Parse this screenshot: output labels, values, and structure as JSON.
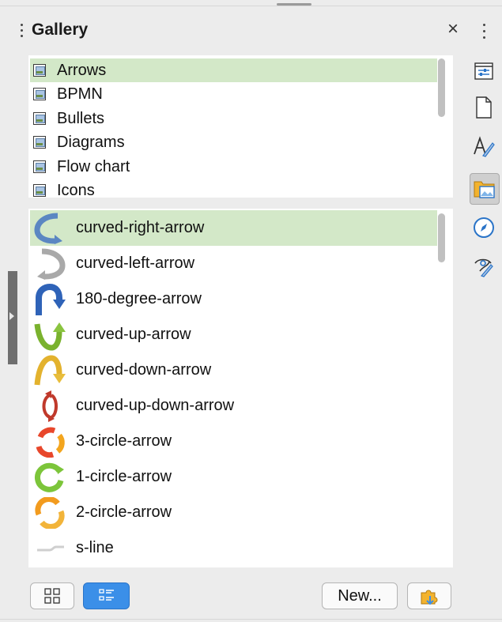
{
  "panel": {
    "title": "Gallery",
    "close_glyph": "×"
  },
  "themes": [
    {
      "label": "Arrows",
      "selected": true
    },
    {
      "label": "BPMN",
      "selected": false
    },
    {
      "label": "Bullets",
      "selected": false
    },
    {
      "label": "Diagrams",
      "selected": false
    },
    {
      "label": "Flow chart",
      "selected": false
    },
    {
      "label": "Icons",
      "selected": false
    }
  ],
  "items": [
    {
      "label": "curved-right-arrow",
      "selected": true,
      "icon": "curved-right-arrow-icon"
    },
    {
      "label": "curved-left-arrow",
      "selected": false,
      "icon": "curved-left-arrow-icon"
    },
    {
      "label": "180-degree-arrow",
      "selected": false,
      "icon": "u-turn-arrow-icon"
    },
    {
      "label": "curved-up-arrow",
      "selected": false,
      "icon": "curved-up-arrow-icon"
    },
    {
      "label": "curved-down-arrow",
      "selected": false,
      "icon": "curved-down-arrow-icon"
    },
    {
      "label": "curved-up-down-arrow",
      "selected": false,
      "icon": "curved-up-down-arrow-icon"
    },
    {
      "label": "3-circle-arrow",
      "selected": false,
      "icon": "three-circle-arrow-icon"
    },
    {
      "label": "1-circle-arrow",
      "selected": false,
      "icon": "one-circle-arrow-icon"
    },
    {
      "label": "2-circle-arrow",
      "selected": false,
      "icon": "two-circle-arrow-icon"
    },
    {
      "label": "s-line",
      "selected": false,
      "icon": "s-line-icon"
    }
  ],
  "toolbar": {
    "icon_view": "icon-view",
    "detail_view": "detail-view",
    "new_label": "New...",
    "properties": "theme-properties"
  },
  "sidebar_deck": [
    "properties-icon",
    "page-icon",
    "styles-icon",
    "gallery-icon",
    "navigator-icon",
    "accessibility-check-icon"
  ],
  "colors": {
    "selection": "#d3e8c8",
    "active_view_button": "#3b8fe8",
    "panel_bg": "#ececec"
  }
}
